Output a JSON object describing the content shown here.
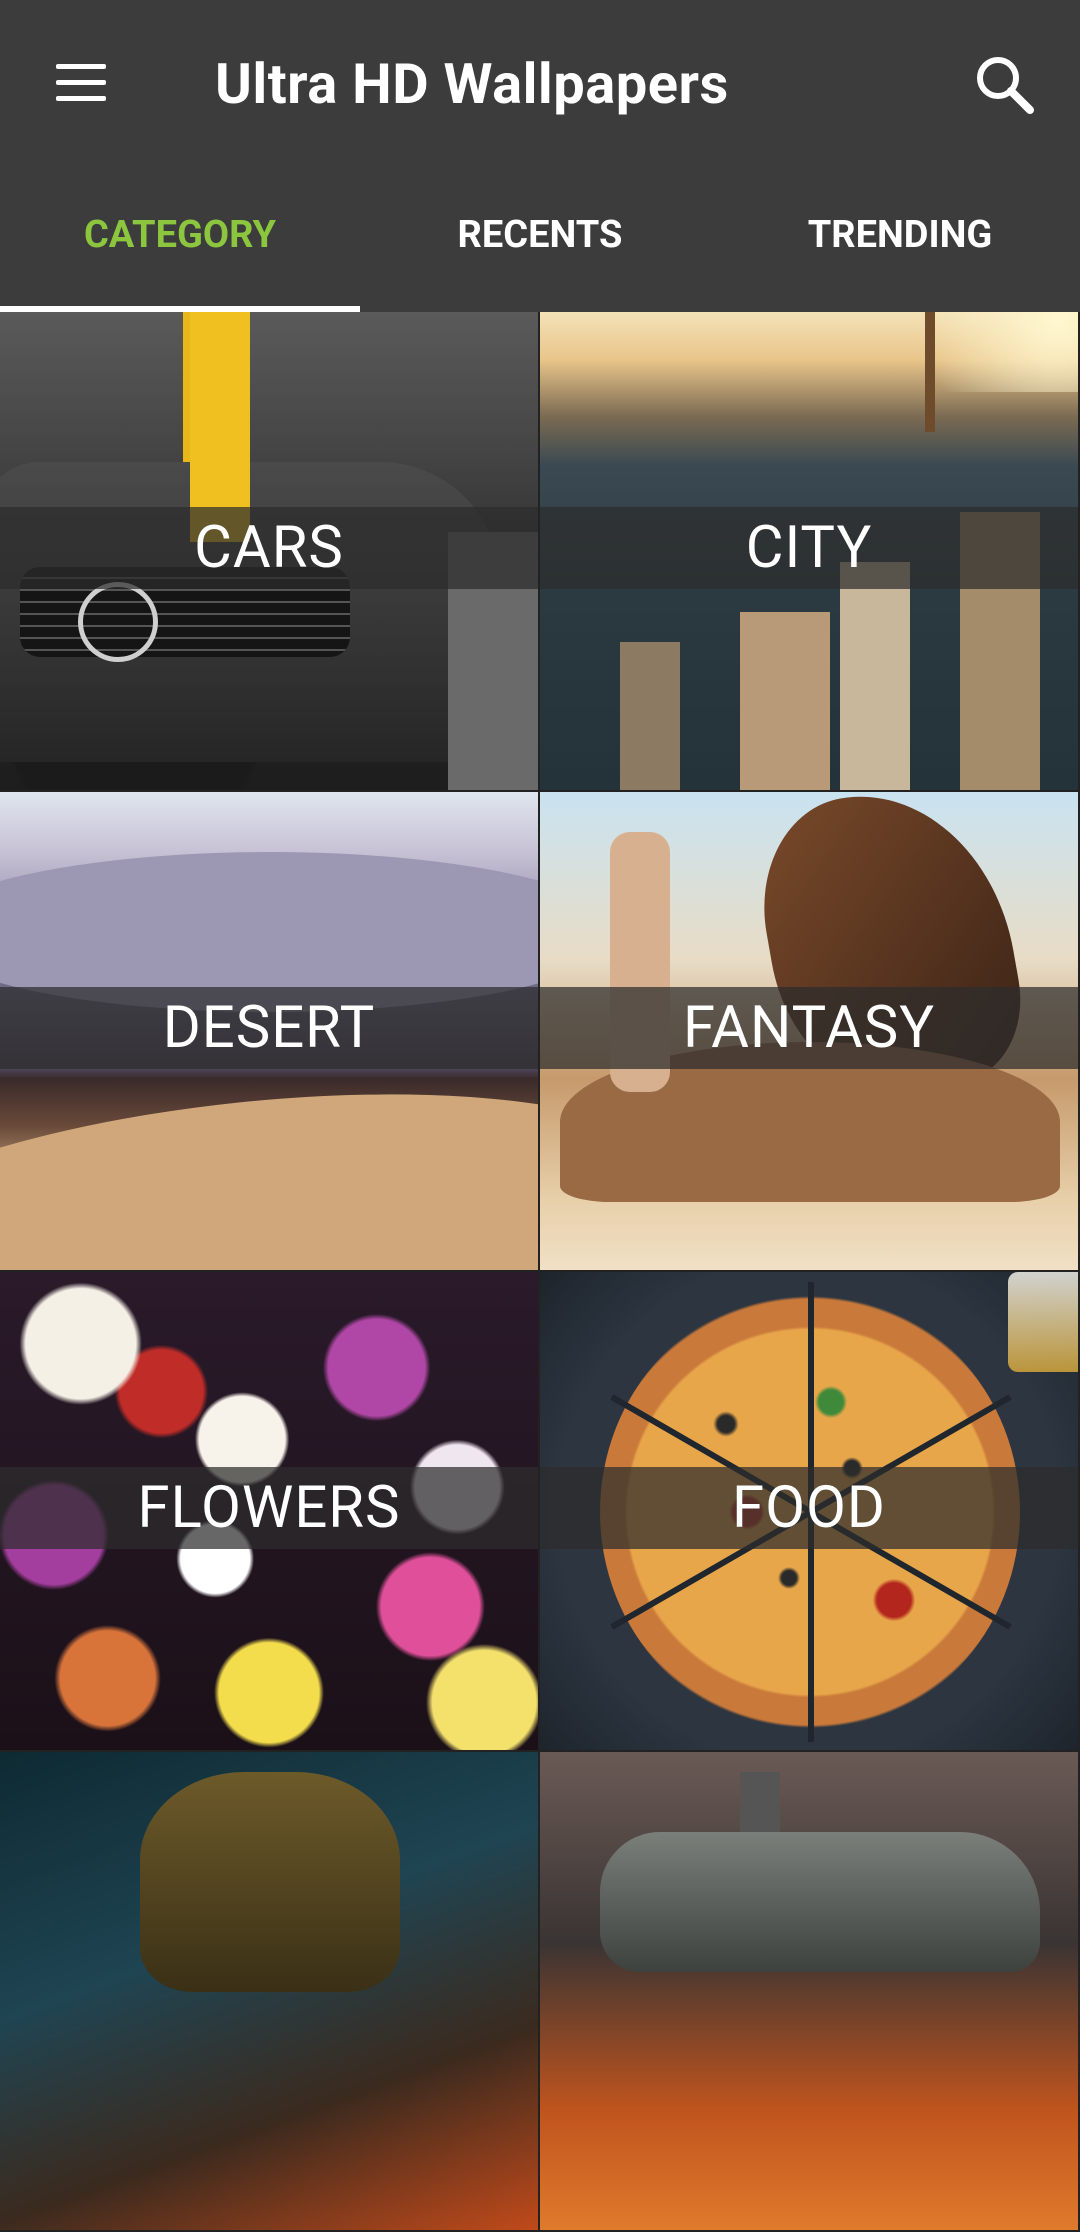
{
  "appbar": {
    "title": "Ultra HD Wallpapers",
    "menu_icon": "hamburger-menu-icon",
    "search_icon": "search-icon"
  },
  "tabs": [
    {
      "label": "CATEGORY",
      "active": true
    },
    {
      "label": "RECENTS",
      "active": false
    },
    {
      "label": "TRENDING",
      "active": false
    }
  ],
  "colors": {
    "appbar_bg": "#3c3c3c",
    "active_tab": "#8cc63f",
    "text": "#ffffff"
  },
  "categories": [
    {
      "label": "CARS"
    },
    {
      "label": "CITY"
    },
    {
      "label": "DESERT"
    },
    {
      "label": "FANTASY"
    },
    {
      "label": "FLOWERS"
    },
    {
      "label": "FOOD"
    },
    {
      "label": ""
    },
    {
      "label": ""
    }
  ]
}
